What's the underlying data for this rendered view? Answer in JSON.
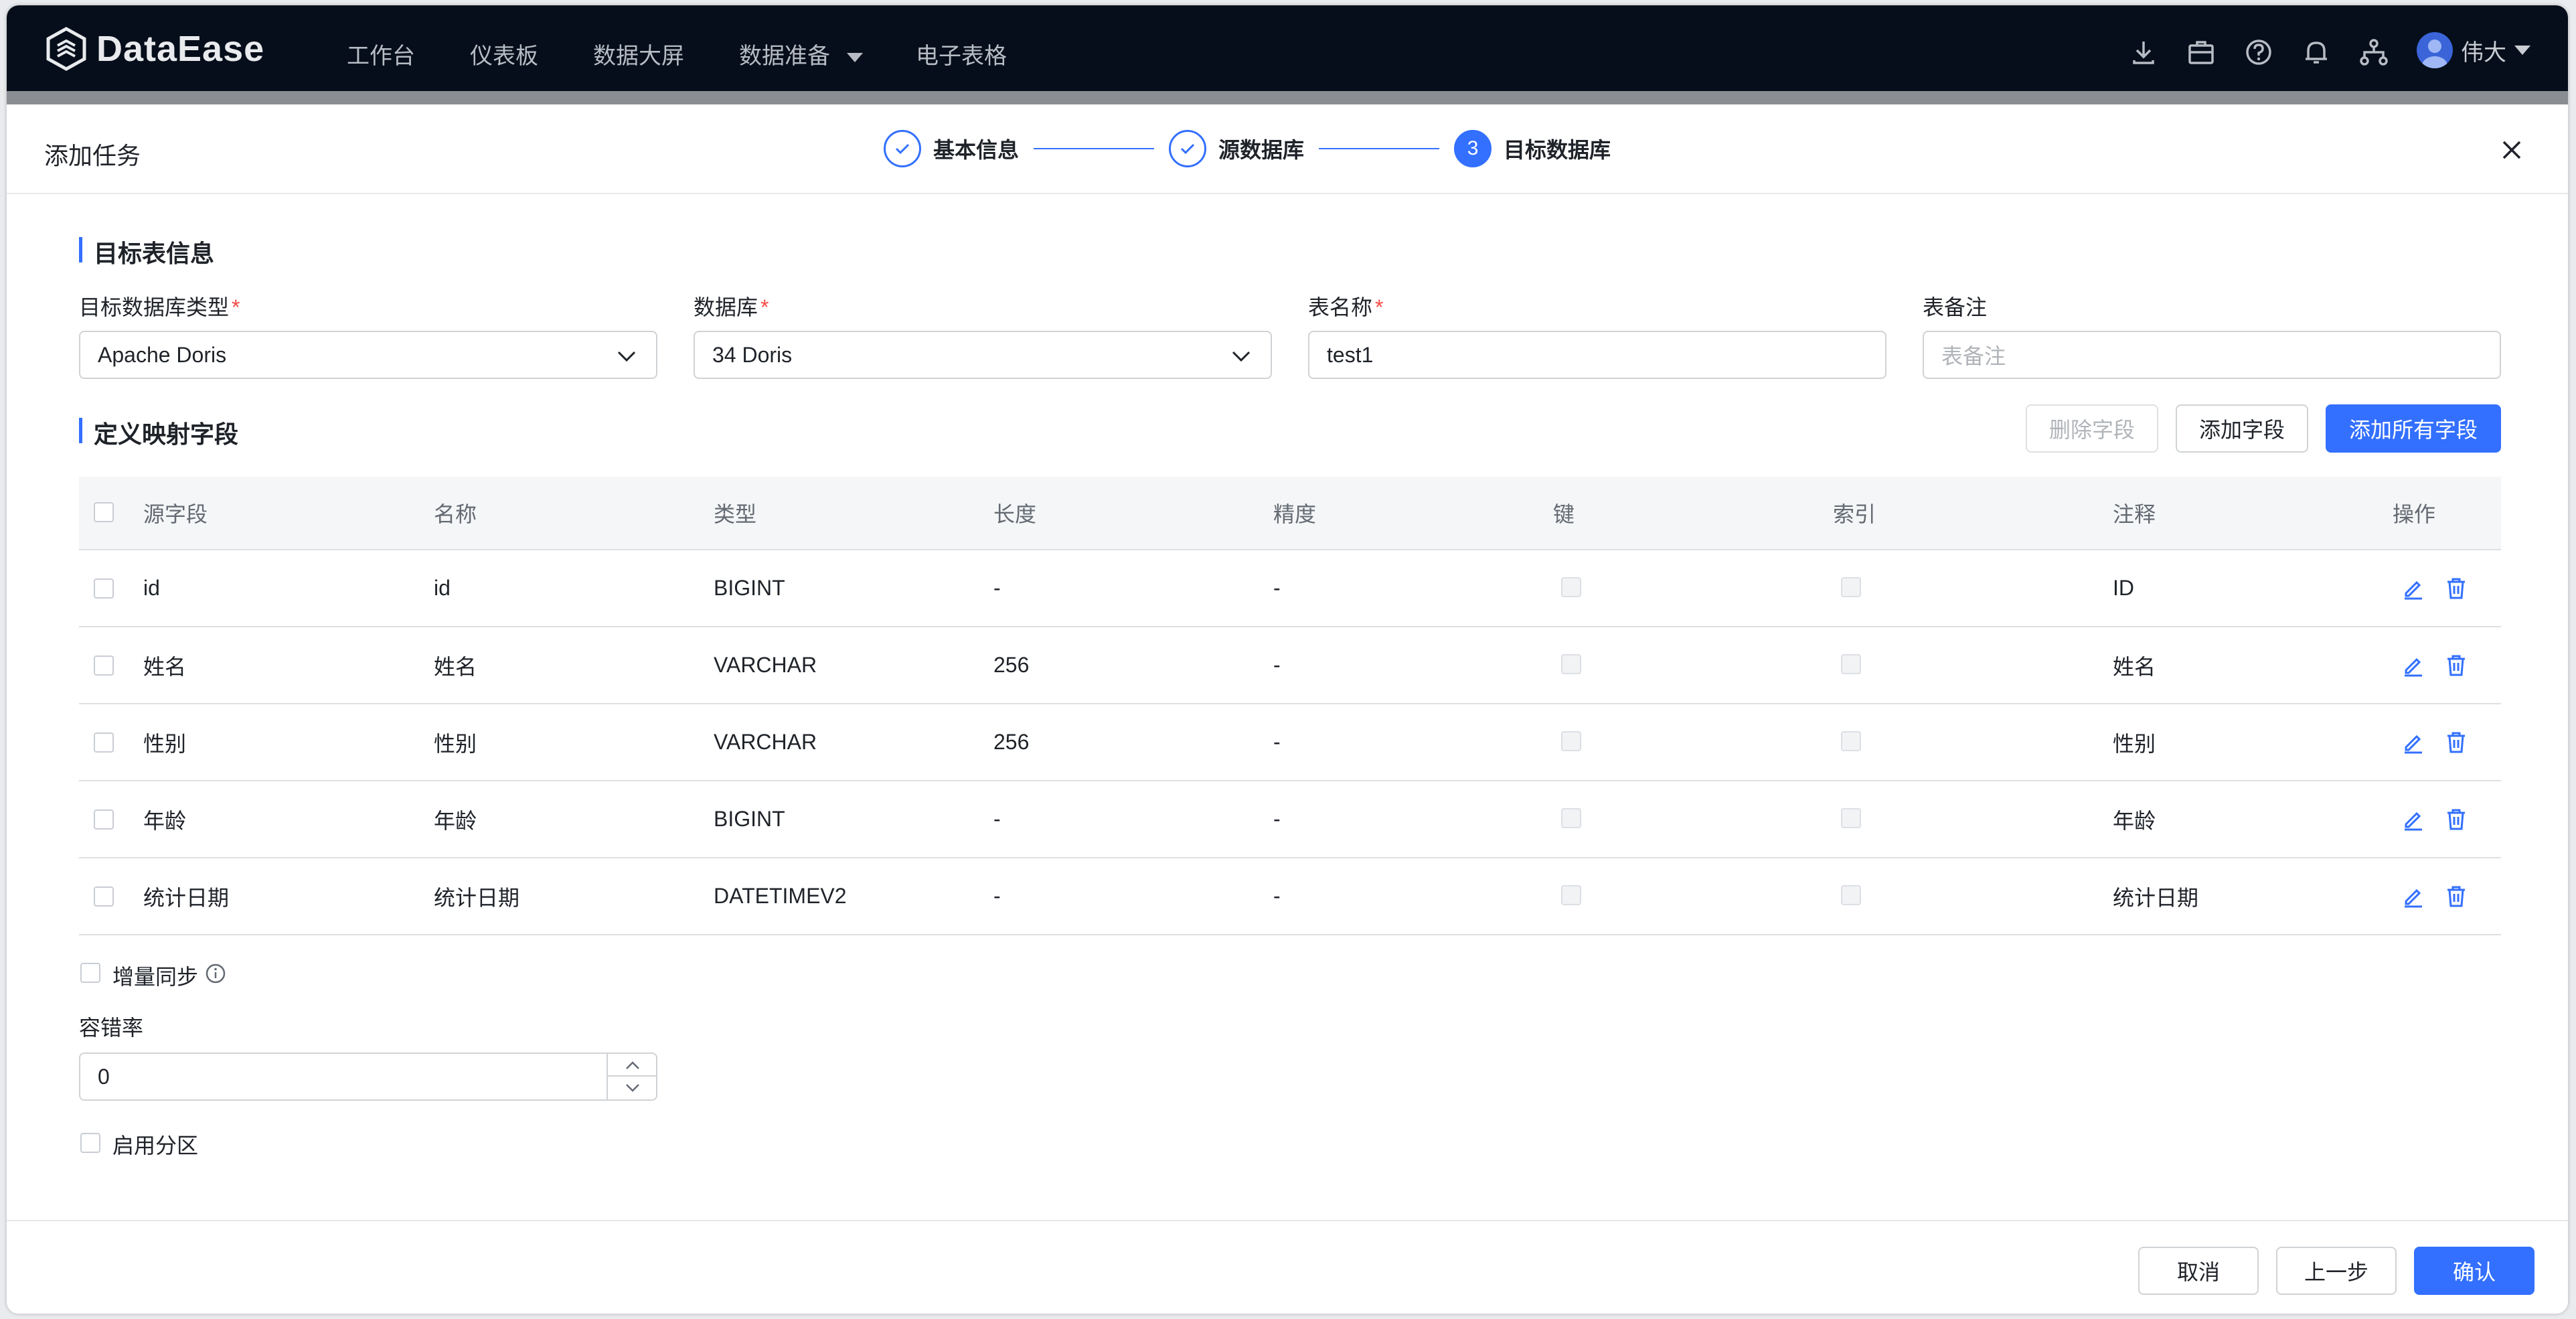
{
  "app": {
    "brand": "DataEase",
    "nav": [
      "工作台",
      "仪表板",
      "数据大屏",
      "数据准备",
      "电子表格"
    ],
    "user": "伟大"
  },
  "dialog": {
    "title": "添加任务",
    "steps": [
      {
        "label": "基本信息",
        "state": "done"
      },
      {
        "label": "源数据库",
        "state": "done"
      },
      {
        "label": "目标数据库",
        "state": "active",
        "number": "3"
      }
    ]
  },
  "target": {
    "section_title": "目标表信息",
    "db_type_label": "目标数据库类型",
    "db_type_value": "Apache Doris",
    "database_label": "数据库",
    "database_value": "34 Doris",
    "table_name_label": "表名称",
    "table_name_value": "test1",
    "table_comment_label": "表备注",
    "table_comment_placeholder": "表备注"
  },
  "mapping": {
    "section_title": "定义映射字段",
    "delete_label": "删除字段",
    "add_label": "添加字段",
    "add_all_label": "添加所有字段",
    "columns": [
      "源字段",
      "名称",
      "类型",
      "长度",
      "精度",
      "键",
      "索引",
      "注释",
      "操作"
    ],
    "rows": [
      {
        "source": "id",
        "name": "id",
        "type": "BIGINT",
        "length": "-",
        "precision": "-",
        "comment": "ID"
      },
      {
        "source": "姓名",
        "name": "姓名",
        "type": "VARCHAR",
        "length": "256",
        "precision": "-",
        "comment": "姓名"
      },
      {
        "source": "性别",
        "name": "性别",
        "type": "VARCHAR",
        "length": "256",
        "precision": "-",
        "comment": "性别"
      },
      {
        "source": "年龄",
        "name": "年龄",
        "type": "BIGINT",
        "length": "-",
        "precision": "-",
        "comment": "年龄"
      },
      {
        "source": "统计日期",
        "name": "统计日期",
        "type": "DATETIMEV2",
        "length": "-",
        "precision": "-",
        "comment": "统计日期"
      }
    ]
  },
  "options": {
    "incremental_label": "增量同步",
    "tolerance_label": "容错率",
    "tolerance_value": "0",
    "partition_label": "启用分区"
  },
  "footer": {
    "cancel_label": "取消",
    "prev_label": "上一步",
    "confirm_label": "确认"
  },
  "colors": {
    "accent": "#3370ff",
    "nav_bg": "#050e1a",
    "required": "#f54a45"
  }
}
